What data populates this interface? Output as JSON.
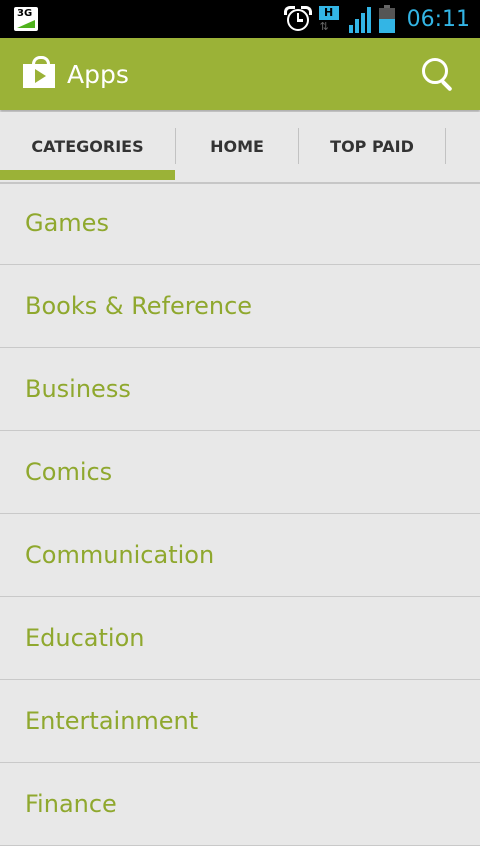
{
  "status_bar": {
    "network_type": "3G",
    "data_indicator": "H",
    "time": "06:11",
    "icons": [
      "3g-data-icon",
      "alarm-clock-icon",
      "hspa-data-icon",
      "signal-strength-icon",
      "battery-icon"
    ],
    "signal_bars": 4,
    "battery_level_fraction": 0.55,
    "accent_color": "#33b5e5"
  },
  "action_bar": {
    "title": "Apps",
    "icons": [
      "play-store-bag-icon",
      "search-icon"
    ],
    "brand_color": "#9bb237"
  },
  "tabs": [
    {
      "label": "CATEGORIES",
      "selected": true
    },
    {
      "label": "HOME",
      "selected": false
    },
    {
      "label": "TOP PAID",
      "selected": false
    }
  ],
  "categories": [
    "Games",
    "Books & Reference",
    "Business",
    "Comics",
    "Communication",
    "Education",
    "Entertainment",
    "Finance"
  ],
  "category_text_color": "#8fa82e"
}
